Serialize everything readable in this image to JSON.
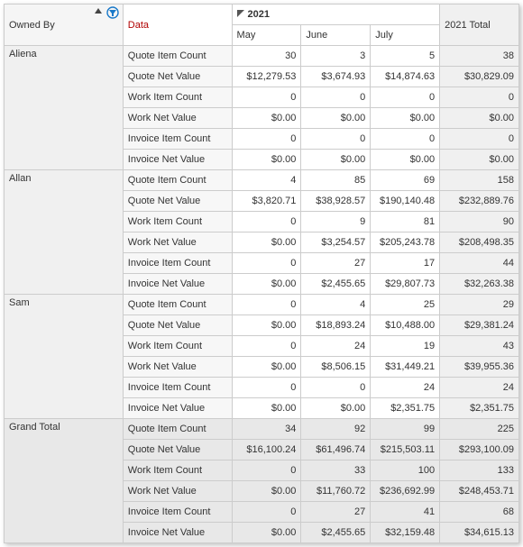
{
  "headers": {
    "owned_by": "Owned By",
    "data": "Data",
    "year": "2021",
    "months": [
      "May",
      "June",
      "July"
    ],
    "year_total": "2021 Total"
  },
  "metrics": [
    "Quote Item Count",
    "Quote Net Value",
    "Work Item Count",
    "Work Net Value",
    "Invoice Item Count",
    "Invoice Net Value"
  ],
  "owners": [
    "Aliena",
    "Allan",
    "Sam",
    "Grand Total"
  ],
  "values": {
    "Aliena": [
      [
        "30",
        "3",
        "5",
        "38"
      ],
      [
        "$12,279.53",
        "$3,674.93",
        "$14,874.63",
        "$30,829.09"
      ],
      [
        "0",
        "0",
        "0",
        "0"
      ],
      [
        "$0.00",
        "$0.00",
        "$0.00",
        "$0.00"
      ],
      [
        "0",
        "0",
        "0",
        "0"
      ],
      [
        "$0.00",
        "$0.00",
        "$0.00",
        "$0.00"
      ]
    ],
    "Allan": [
      [
        "4",
        "85",
        "69",
        "158"
      ],
      [
        "$3,820.71",
        "$38,928.57",
        "$190,140.48",
        "$232,889.76"
      ],
      [
        "0",
        "9",
        "81",
        "90"
      ],
      [
        "$0.00",
        "$3,254.57",
        "$205,243.78",
        "$208,498.35"
      ],
      [
        "0",
        "27",
        "17",
        "44"
      ],
      [
        "$0.00",
        "$2,455.65",
        "$29,807.73",
        "$32,263.38"
      ]
    ],
    "Sam": [
      [
        "0",
        "4",
        "25",
        "29"
      ],
      [
        "$0.00",
        "$18,893.24",
        "$10,488.00",
        "$29,381.24"
      ],
      [
        "0",
        "24",
        "19",
        "43"
      ],
      [
        "$0.00",
        "$8,506.15",
        "$31,449.21",
        "$39,955.36"
      ],
      [
        "0",
        "0",
        "24",
        "24"
      ],
      [
        "$0.00",
        "$0.00",
        "$2,351.75",
        "$2,351.75"
      ]
    ],
    "Grand Total": [
      [
        "34",
        "92",
        "99",
        "225"
      ],
      [
        "$16,100.24",
        "$61,496.74",
        "$215,503.11",
        "$293,100.09"
      ],
      [
        "0",
        "33",
        "100",
        "133"
      ],
      [
        "$0.00",
        "$11,760.72",
        "$236,692.99",
        "$248,453.71"
      ],
      [
        "0",
        "27",
        "41",
        "68"
      ],
      [
        "$0.00",
        "$2,455.65",
        "$32,159.48",
        "$34,615.13"
      ]
    ]
  },
  "chart_data": {
    "type": "table",
    "title": "Pivot: Owned By × Metric × Month (2021)",
    "row_fields": [
      "Owned By",
      "Data"
    ],
    "column_fields": [
      "2021 Month",
      "2021 Total"
    ],
    "columns": [
      "May",
      "June",
      "July",
      "2021 Total"
    ],
    "rows": [
      {
        "owner": "Aliena",
        "metric": "Quote Item Count",
        "May": 30,
        "June": 3,
        "July": 5,
        "Total": 38
      },
      {
        "owner": "Aliena",
        "metric": "Quote Net Value",
        "May": 12279.53,
        "June": 3674.93,
        "July": 14874.63,
        "Total": 30829.09
      },
      {
        "owner": "Aliena",
        "metric": "Work Item Count",
        "May": 0,
        "June": 0,
        "July": 0,
        "Total": 0
      },
      {
        "owner": "Aliena",
        "metric": "Work Net Value",
        "May": 0.0,
        "June": 0.0,
        "July": 0.0,
        "Total": 0.0
      },
      {
        "owner": "Aliena",
        "metric": "Invoice Item Count",
        "May": 0,
        "June": 0,
        "July": 0,
        "Total": 0
      },
      {
        "owner": "Aliena",
        "metric": "Invoice Net Value",
        "May": 0.0,
        "June": 0.0,
        "July": 0.0,
        "Total": 0.0
      },
      {
        "owner": "Allan",
        "metric": "Quote Item Count",
        "May": 4,
        "June": 85,
        "July": 69,
        "Total": 158
      },
      {
        "owner": "Allan",
        "metric": "Quote Net Value",
        "May": 3820.71,
        "June": 38928.57,
        "July": 190140.48,
        "Total": 232889.76
      },
      {
        "owner": "Allan",
        "metric": "Work Item Count",
        "May": 0,
        "June": 9,
        "July": 81,
        "Total": 90
      },
      {
        "owner": "Allan",
        "metric": "Work Net Value",
        "May": 0.0,
        "June": 3254.57,
        "July": 205243.78,
        "Total": 208498.35
      },
      {
        "owner": "Allan",
        "metric": "Invoice Item Count",
        "May": 0,
        "June": 27,
        "July": 17,
        "Total": 44
      },
      {
        "owner": "Allan",
        "metric": "Invoice Net Value",
        "May": 0.0,
        "June": 2455.65,
        "July": 29807.73,
        "Total": 32263.38
      },
      {
        "owner": "Sam",
        "metric": "Quote Item Count",
        "May": 0,
        "June": 4,
        "July": 25,
        "Total": 29
      },
      {
        "owner": "Sam",
        "metric": "Quote Net Value",
        "May": 0.0,
        "June": 18893.24,
        "July": 10488.0,
        "Total": 29381.24
      },
      {
        "owner": "Sam",
        "metric": "Work Item Count",
        "May": 0,
        "June": 24,
        "July": 19,
        "Total": 43
      },
      {
        "owner": "Sam",
        "metric": "Work Net Value",
        "May": 0.0,
        "June": 8506.15,
        "July": 31449.21,
        "Total": 39955.36
      },
      {
        "owner": "Sam",
        "metric": "Invoice Item Count",
        "May": 0,
        "June": 0,
        "July": 24,
        "Total": 24
      },
      {
        "owner": "Sam",
        "metric": "Invoice Net Value",
        "May": 0.0,
        "June": 0.0,
        "July": 2351.75,
        "Total": 2351.75
      },
      {
        "owner": "Grand Total",
        "metric": "Quote Item Count",
        "May": 34,
        "June": 92,
        "July": 99,
        "Total": 225
      },
      {
        "owner": "Grand Total",
        "metric": "Quote Net Value",
        "May": 16100.24,
        "June": 61496.74,
        "July": 215503.11,
        "Total": 293100.09
      },
      {
        "owner": "Grand Total",
        "metric": "Work Item Count",
        "May": 0,
        "June": 33,
        "July": 100,
        "Total": 133
      },
      {
        "owner": "Grand Total",
        "metric": "Work Net Value",
        "May": 0.0,
        "June": 11760.72,
        "July": 236692.99,
        "Total": 248453.71
      },
      {
        "owner": "Grand Total",
        "metric": "Invoice Item Count",
        "May": 0,
        "June": 27,
        "July": 41,
        "Total": 68
      },
      {
        "owner": "Grand Total",
        "metric": "Invoice Net Value",
        "May": 0.0,
        "June": 2455.65,
        "July": 32159.48,
        "Total": 34615.13
      }
    ]
  }
}
